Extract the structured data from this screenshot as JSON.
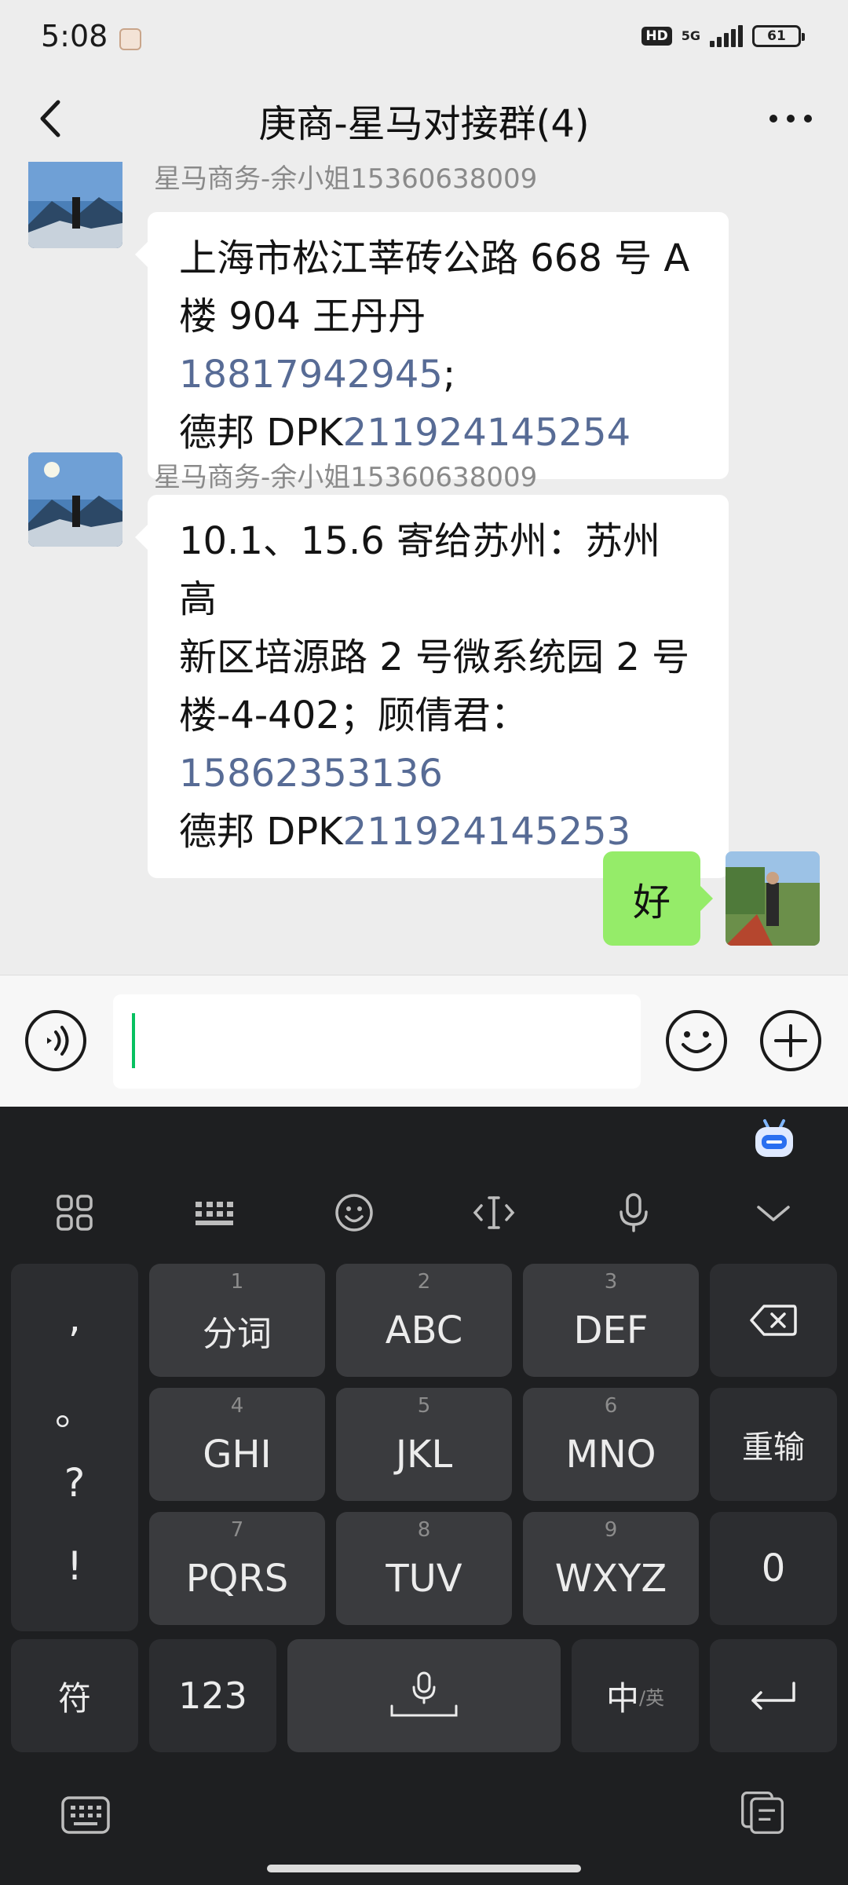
{
  "status_bar": {
    "time": "5:08",
    "hd_label": "HD",
    "network_label": "5G",
    "battery": "61"
  },
  "header": {
    "title": "庚商-星马对接群(4)"
  },
  "messages": [
    {
      "sender": "星马商务-余小姐15360638009",
      "lines": [
        [
          {
            "text": "上海市松江莘砖公路 668 号 A"
          }
        ],
        [
          {
            "text": "楼 904 王丹丹 "
          },
          {
            "text": "18817942945",
            "link": true
          },
          {
            "text": ";"
          }
        ],
        [
          {
            "text": "德邦 DPK"
          },
          {
            "text": "211924145254",
            "link": true
          }
        ]
      ]
    },
    {
      "sender": "星马商务-余小姐15360638009",
      "lines": [
        [
          {
            "text": "10.1、15.6 寄给苏州：苏州高"
          }
        ],
        [
          {
            "text": "新区培源路 2 号微系统园 2 号"
          }
        ],
        [
          {
            "text": "楼-4-402；顾倩君："
          }
        ],
        [
          {
            "text": "15862353136",
            "link": true
          }
        ],
        [
          {
            "text": "德邦  DPK"
          },
          {
            "text": "211924145253",
            "link": true
          }
        ]
      ]
    }
  ],
  "outgoing_message": "好",
  "keyboard": {
    "punctuation": [
      ",",
      "。",
      "?",
      "!"
    ],
    "keys_row1": [
      {
        "num": "1",
        "label": "分词"
      },
      {
        "num": "2",
        "label": "ABC"
      },
      {
        "num": "3",
        "label": "DEF"
      }
    ],
    "keys_row2": [
      {
        "num": "4",
        "label": "GHI"
      },
      {
        "num": "5",
        "label": "JKL"
      },
      {
        "num": "6",
        "label": "MNO"
      }
    ],
    "keys_row3": [
      {
        "num": "7",
        "label": "PQRS"
      },
      {
        "num": "8",
        "label": "TUV"
      },
      {
        "num": "9",
        "label": "WXYZ"
      }
    ],
    "reset_label": "重输",
    "zero_label": "0",
    "symbol_label": "符",
    "numbers_label": "123",
    "lang_main": "中",
    "lang_alt": "/英"
  },
  "colors": {
    "link": "#576b95",
    "outgoing_bubble": "#95ec69",
    "cursor": "#07c160",
    "keyboard_bg": "#1e1f21"
  },
  "icons": [
    "back-icon",
    "more-icon",
    "voice-icon",
    "emoji-icon",
    "plus-icon",
    "apps-grid-icon",
    "keyboard-layout-icon",
    "smiley-icon",
    "text-cursor-icon",
    "microphone-icon",
    "collapse-icon",
    "backspace-icon",
    "enter-icon",
    "keyboard-switch-icon",
    "clipboard-icon"
  ]
}
